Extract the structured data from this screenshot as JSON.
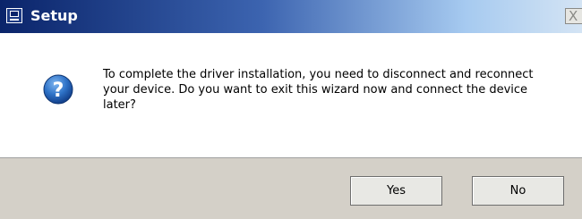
{
  "window": {
    "title": "Setup",
    "close_glyph": "X"
  },
  "dialog": {
    "icon": "question-icon",
    "message": "To complete the driver installation, you need to disconnect and reconnect your device. Do you want to exit this wizard now and connect the device later?"
  },
  "buttons": {
    "yes_label": "Yes",
    "no_label": "No"
  },
  "colors": {
    "titlebar_start": "#0a246a",
    "titlebar_end": "#d4e4f4",
    "footer_bg": "#d4d0c8",
    "question_icon": "#1f63b8"
  }
}
